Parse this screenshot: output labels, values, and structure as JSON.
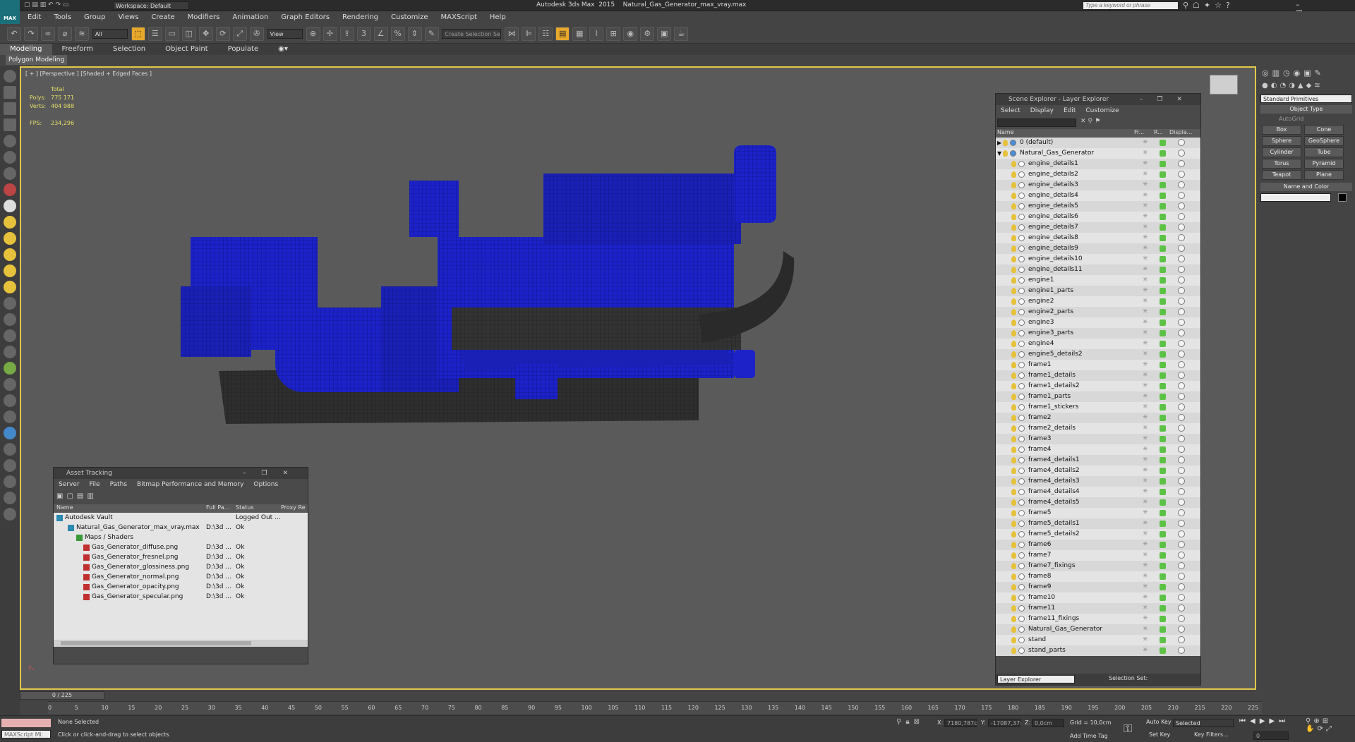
{
  "app": {
    "title": "Autodesk 3ds Max  2015    Natural_Gas_Generator_max_vray.max",
    "logo": "MAX",
    "workspace": "Workspace: Default",
    "search_placeholder": "Type a keyword or phrase"
  },
  "menu": [
    "Edit",
    "Tools",
    "Group",
    "Views",
    "Create",
    "Modifiers",
    "Animation",
    "Graph Editors",
    "Rendering",
    "Customize",
    "MAXScript",
    "Help"
  ],
  "toolbar": {
    "filter": "All",
    "refcoord": "View",
    "selection_set": "Create Selection Se"
  },
  "ribbon": {
    "tabs": [
      "Modeling",
      "Freeform",
      "Selection",
      "Object Paint",
      "Populate"
    ],
    "sub": "Polygon Modeling"
  },
  "viewport": {
    "label": "[ + ] [Perspective ] [Shaded + Edged Faces ]",
    "stats_total": "Total",
    "polys_label": "Polys:",
    "polys": "775 171",
    "verts_label": "Verts:",
    "verts": "404 988",
    "fps_label": "FPS:",
    "fps": "234,296"
  },
  "command_panel": {
    "dropdown": "Standard Primitives",
    "object_type": "Object Type",
    "autogrid": "AutoGrid",
    "primitives": [
      "Box",
      "Cone",
      "Sphere",
      "GeoSphere",
      "Cylinder",
      "Tube",
      "Torus",
      "Pyramid",
      "Teapot",
      "Plane"
    ],
    "name_color": "Name and Color"
  },
  "scene_explorer": {
    "title": "Scene Explorer - Layer Explorer",
    "menu": [
      "Select",
      "Display",
      "Edit",
      "Customize"
    ],
    "columns": [
      "Name",
      "Fr...",
      "R...",
      "Displa..."
    ],
    "items": [
      "0 (default)",
      "Natural_Gas_Generator",
      "engine_details1",
      "engine_details2",
      "engine_details3",
      "engine_details4",
      "engine_details5",
      "engine_details6",
      "engine_details7",
      "engine_details8",
      "engine_details9",
      "engine_details10",
      "engine_details11",
      "engine1",
      "engine1_parts",
      "engine2",
      "engine2_parts",
      "engine3",
      "engine3_parts",
      "engine4",
      "engine5_details2",
      "frame1",
      "frame1_details",
      "frame1_details2",
      "frame1_parts",
      "frame1_stickers",
      "frame2",
      "frame2_details",
      "frame3",
      "frame4",
      "frame4_details1",
      "frame4_details2",
      "frame4_details3",
      "frame4_details4",
      "frame4_details5",
      "frame5",
      "frame5_details1",
      "frame5_details2",
      "frame6",
      "frame7",
      "frame7_fixings",
      "frame8",
      "frame9",
      "frame10",
      "frame11",
      "frame11_fixings",
      "Natural_Gas_Generator",
      "stand",
      "stand_parts"
    ],
    "footer_mode": "Layer Explorer",
    "selection_set": "Selection Set:"
  },
  "asset_tracking": {
    "title": "Asset Tracking",
    "menu": [
      "Server",
      "File",
      "Paths",
      "Bitmap Performance and Memory",
      "Options"
    ],
    "columns": [
      "Name",
      "Full Pa...",
      "Status",
      "Proxy Re"
    ],
    "rows": [
      {
        "name": "Autodesk Vault",
        "path": "",
        "status": "Logged Out ..."
      },
      {
        "name": "Natural_Gas_Generator_max_vray.max",
        "path": "D:\\3d ...",
        "status": "Ok"
      },
      {
        "name": "Maps / Shaders",
        "path": "",
        "status": ""
      },
      {
        "name": "Gas_Generator_diffuse.png",
        "path": "D:\\3d ...",
        "status": "Ok"
      },
      {
        "name": "Gas_Generator_fresnel.png",
        "path": "D:\\3d ...",
        "status": "Ok"
      },
      {
        "name": "Gas_Generator_glossiness.png",
        "path": "D:\\3d ...",
        "status": "Ok"
      },
      {
        "name": "Gas_Generator_normal.png",
        "path": "D:\\3d ...",
        "status": "Ok"
      },
      {
        "name": "Gas_Generator_opacity.png",
        "path": "D:\\3d ...",
        "status": "Ok"
      },
      {
        "name": "Gas_Generator_specular.png",
        "path": "D:\\3d ...",
        "status": "Ok"
      }
    ]
  },
  "timeline": {
    "frame_counter": "0 / 225",
    "ticks": [
      "0",
      "5",
      "10",
      "15",
      "20",
      "25",
      "30",
      "35",
      "40",
      "45",
      "50",
      "55",
      "60",
      "65",
      "70",
      "75",
      "80",
      "85",
      "90",
      "95",
      "100",
      "105",
      "110",
      "115",
      "120",
      "125",
      "130",
      "135",
      "140",
      "145",
      "150",
      "155",
      "160",
      "165",
      "170",
      "175",
      "180",
      "185",
      "190",
      "195",
      "200",
      "205",
      "210",
      "215",
      "220",
      "225"
    ]
  },
  "status": {
    "maxscript": "MAXScript Mi:",
    "selection": "None Selected",
    "prompt": "Click or click-and-drag to select objects",
    "x_label": "X:",
    "x": "7180,787c",
    "y_label": "Y:",
    "y": "-17087,37:",
    "z_label": "Z:",
    "z": "0,0cm",
    "grid": "Grid = 10,0cm",
    "add_time_tag": "Add Time Tag",
    "auto_key": "Auto Key",
    "set_key": "Set Key",
    "selected": "Selected",
    "key_filters": "Key Filters...",
    "frame": "0"
  },
  "colors": {
    "accent_border": "#e2c94a",
    "model_blue": "#1c22c8",
    "model_dark": "#2e2e2e"
  }
}
